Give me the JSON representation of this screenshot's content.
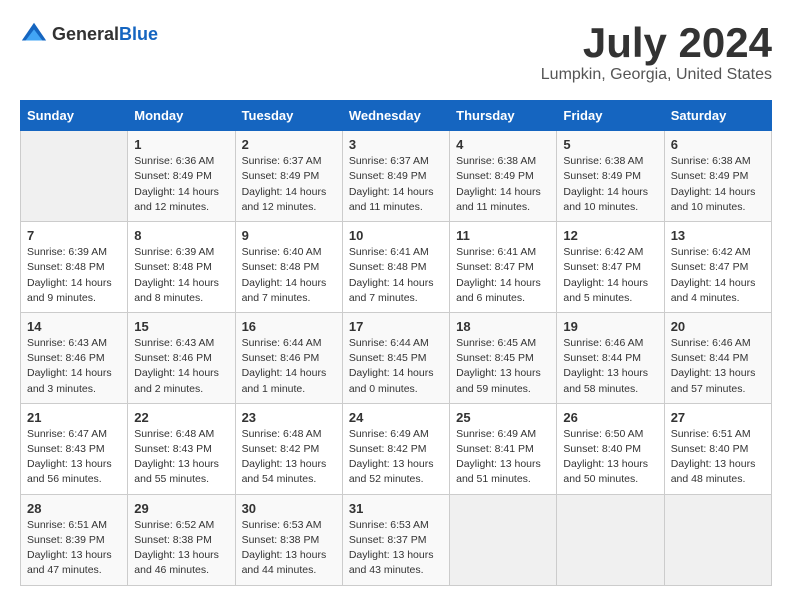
{
  "logo": {
    "general": "General",
    "blue": "Blue"
  },
  "title": "July 2024",
  "subtitle": "Lumpkin, Georgia, United States",
  "days_of_week": [
    "Sunday",
    "Monday",
    "Tuesday",
    "Wednesday",
    "Thursday",
    "Friday",
    "Saturday"
  ],
  "weeks": [
    [
      {
        "day": "",
        "content": ""
      },
      {
        "day": "1",
        "content": "Sunrise: 6:36 AM\nSunset: 8:49 PM\nDaylight: 14 hours and 12 minutes."
      },
      {
        "day": "2",
        "content": "Sunrise: 6:37 AM\nSunset: 8:49 PM\nDaylight: 14 hours and 12 minutes."
      },
      {
        "day": "3",
        "content": "Sunrise: 6:37 AM\nSunset: 8:49 PM\nDaylight: 14 hours and 11 minutes."
      },
      {
        "day": "4",
        "content": "Sunrise: 6:38 AM\nSunset: 8:49 PM\nDaylight: 14 hours and 11 minutes."
      },
      {
        "day": "5",
        "content": "Sunrise: 6:38 AM\nSunset: 8:49 PM\nDaylight: 14 hours and 10 minutes."
      },
      {
        "day": "6",
        "content": "Sunrise: 6:38 AM\nSunset: 8:49 PM\nDaylight: 14 hours and 10 minutes."
      }
    ],
    [
      {
        "day": "7",
        "content": "Sunrise: 6:39 AM\nSunset: 8:48 PM\nDaylight: 14 hours and 9 minutes."
      },
      {
        "day": "8",
        "content": "Sunrise: 6:39 AM\nSunset: 8:48 PM\nDaylight: 14 hours and 8 minutes."
      },
      {
        "day": "9",
        "content": "Sunrise: 6:40 AM\nSunset: 8:48 PM\nDaylight: 14 hours and 7 minutes."
      },
      {
        "day": "10",
        "content": "Sunrise: 6:41 AM\nSunset: 8:48 PM\nDaylight: 14 hours and 7 minutes."
      },
      {
        "day": "11",
        "content": "Sunrise: 6:41 AM\nSunset: 8:47 PM\nDaylight: 14 hours and 6 minutes."
      },
      {
        "day": "12",
        "content": "Sunrise: 6:42 AM\nSunset: 8:47 PM\nDaylight: 14 hours and 5 minutes."
      },
      {
        "day": "13",
        "content": "Sunrise: 6:42 AM\nSunset: 8:47 PM\nDaylight: 14 hours and 4 minutes."
      }
    ],
    [
      {
        "day": "14",
        "content": "Sunrise: 6:43 AM\nSunset: 8:46 PM\nDaylight: 14 hours and 3 minutes."
      },
      {
        "day": "15",
        "content": "Sunrise: 6:43 AM\nSunset: 8:46 PM\nDaylight: 14 hours and 2 minutes."
      },
      {
        "day": "16",
        "content": "Sunrise: 6:44 AM\nSunset: 8:46 PM\nDaylight: 14 hours and 1 minute."
      },
      {
        "day": "17",
        "content": "Sunrise: 6:44 AM\nSunset: 8:45 PM\nDaylight: 14 hours and 0 minutes."
      },
      {
        "day": "18",
        "content": "Sunrise: 6:45 AM\nSunset: 8:45 PM\nDaylight: 13 hours and 59 minutes."
      },
      {
        "day": "19",
        "content": "Sunrise: 6:46 AM\nSunset: 8:44 PM\nDaylight: 13 hours and 58 minutes."
      },
      {
        "day": "20",
        "content": "Sunrise: 6:46 AM\nSunset: 8:44 PM\nDaylight: 13 hours and 57 minutes."
      }
    ],
    [
      {
        "day": "21",
        "content": "Sunrise: 6:47 AM\nSunset: 8:43 PM\nDaylight: 13 hours and 56 minutes."
      },
      {
        "day": "22",
        "content": "Sunrise: 6:48 AM\nSunset: 8:43 PM\nDaylight: 13 hours and 55 minutes."
      },
      {
        "day": "23",
        "content": "Sunrise: 6:48 AM\nSunset: 8:42 PM\nDaylight: 13 hours and 54 minutes."
      },
      {
        "day": "24",
        "content": "Sunrise: 6:49 AM\nSunset: 8:42 PM\nDaylight: 13 hours and 52 minutes."
      },
      {
        "day": "25",
        "content": "Sunrise: 6:49 AM\nSunset: 8:41 PM\nDaylight: 13 hours and 51 minutes."
      },
      {
        "day": "26",
        "content": "Sunrise: 6:50 AM\nSunset: 8:40 PM\nDaylight: 13 hours and 50 minutes."
      },
      {
        "day": "27",
        "content": "Sunrise: 6:51 AM\nSunset: 8:40 PM\nDaylight: 13 hours and 48 minutes."
      }
    ],
    [
      {
        "day": "28",
        "content": "Sunrise: 6:51 AM\nSunset: 8:39 PM\nDaylight: 13 hours and 47 minutes."
      },
      {
        "day": "29",
        "content": "Sunrise: 6:52 AM\nSunset: 8:38 PM\nDaylight: 13 hours and 46 minutes."
      },
      {
        "day": "30",
        "content": "Sunrise: 6:53 AM\nSunset: 8:38 PM\nDaylight: 13 hours and 44 minutes."
      },
      {
        "day": "31",
        "content": "Sunrise: 6:53 AM\nSunset: 8:37 PM\nDaylight: 13 hours and 43 minutes."
      },
      {
        "day": "",
        "content": ""
      },
      {
        "day": "",
        "content": ""
      },
      {
        "day": "",
        "content": ""
      }
    ]
  ]
}
